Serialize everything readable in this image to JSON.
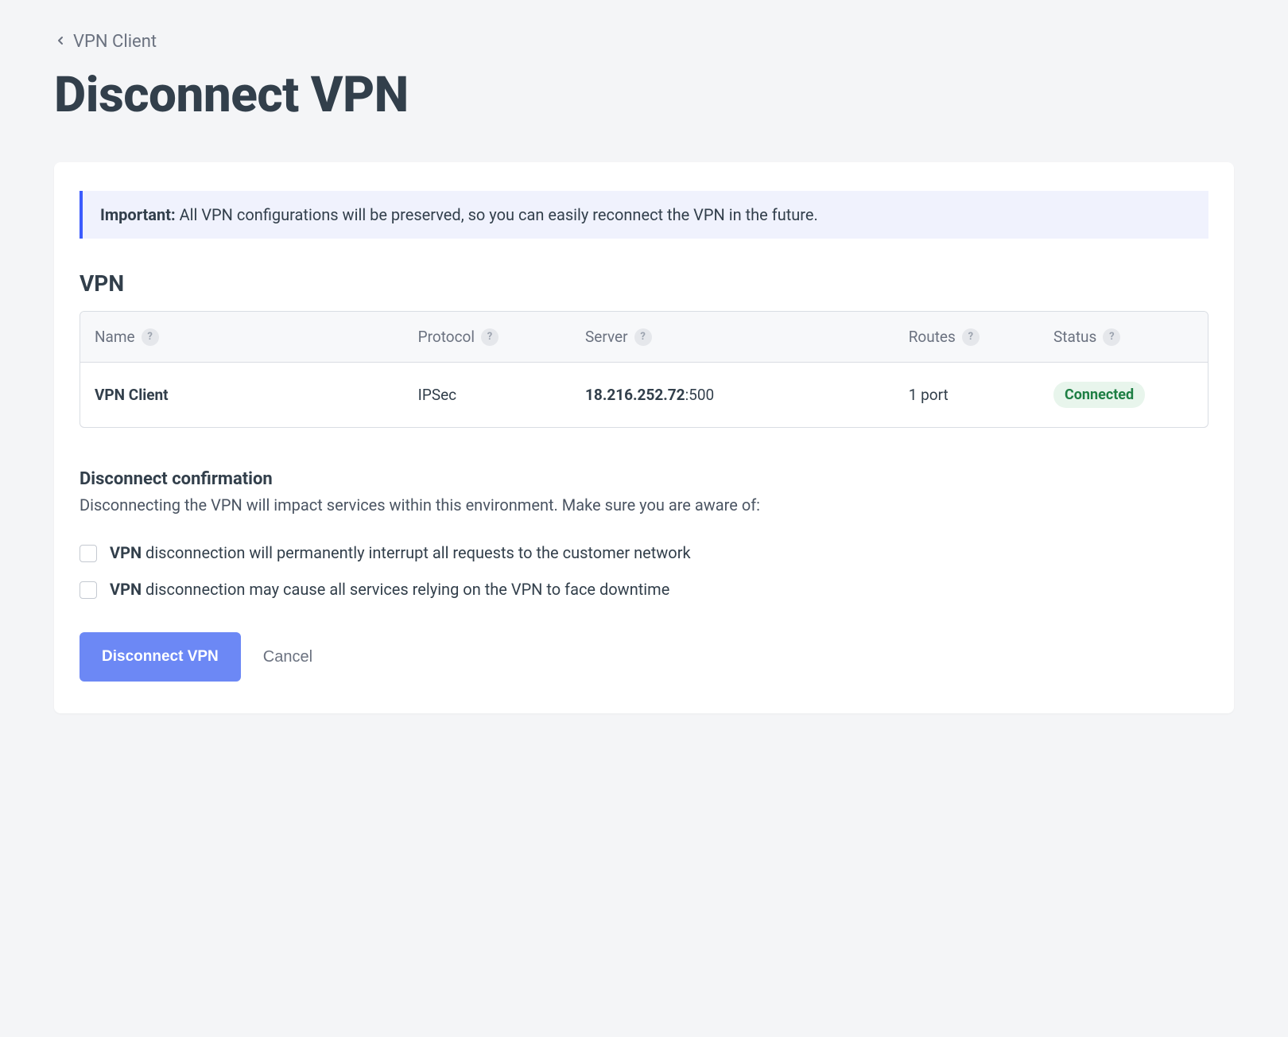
{
  "breadcrumb": {
    "label": "VPN Client"
  },
  "page_title": "Disconnect VPN",
  "banner": {
    "label": "Important:",
    "text": "All VPN configurations will be preserved, so you can easily reconnect the VPN in the future."
  },
  "vpn_section": {
    "heading": "VPN",
    "columns": {
      "name": "Name",
      "protocol": "Protocol",
      "server": "Server",
      "routes": "Routes",
      "status": "Status"
    },
    "row": {
      "name": "VPN Client",
      "protocol": "IPSec",
      "server_ip": "18.216.252.72",
      "server_port": ":500",
      "routes": "1 port",
      "status": "Connected"
    }
  },
  "confirmation": {
    "heading": "Disconnect confirmation",
    "text": "Disconnecting the VPN will impact services within this environment. Make sure you are aware of:",
    "items": [
      {
        "bold": "VPN",
        "text": " disconnection will permanently interrupt all requests to the customer network"
      },
      {
        "bold": "VPN",
        "text": " disconnection may cause all services relying on the VPN to face downtime"
      }
    ]
  },
  "buttons": {
    "primary": "Disconnect VPN",
    "cancel": "Cancel"
  },
  "help_glyph": "?"
}
